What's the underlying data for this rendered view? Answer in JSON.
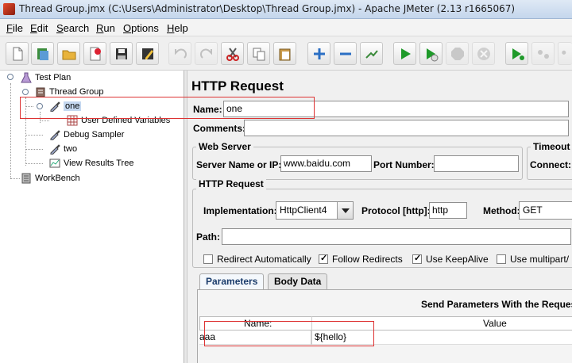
{
  "window": {
    "title": "Thread Group.jmx (C:\\Users\\Administrator\\Desktop\\Thread Group.jmx) - Apache JMeter (2.13 r1665067)"
  },
  "menu": [
    "File",
    "Edit",
    "Search",
    "Run",
    "Options",
    "Help"
  ],
  "toolbar": {
    "icons": [
      "new-icon",
      "templates-icon",
      "open-icon",
      "close-icon",
      "save-icon",
      "save-as-icon",
      "undo-icon",
      "redo-icon",
      "cut-icon",
      "copy-icon",
      "paste-icon",
      "expand-icon",
      "collapse-icon",
      "toggle-icon",
      "start-icon",
      "start-no-pause-icon",
      "stop-icon",
      "shutdown-icon",
      "remote-start-icon",
      "remote-stop-icon",
      "remote-exit-icon"
    ]
  },
  "tree": {
    "test_plan": "Test Plan",
    "thread_group": "Thread Group",
    "one": "one",
    "user_defined_variables": "User Defined Variables",
    "debug_sampler": "Debug Sampler",
    "two": "two",
    "view_results_tree": "View Results Tree",
    "workbench": "WorkBench"
  },
  "panel": {
    "title": "HTTP Request",
    "name_label": "Name:",
    "name_value": "one",
    "comments_label": "Comments:",
    "web_server": {
      "title": "Web Server",
      "server_label": "Server Name or IP:",
      "server_value": "www.baidu.com",
      "port_label": "Port Number:",
      "port_value": ""
    },
    "timeouts": {
      "title": "Timeout",
      "connect_label": "Connect:"
    },
    "http_request": {
      "title": "HTTP Request",
      "impl_label": "Implementation:",
      "impl_value": "HttpClient4",
      "protocol_label": "Protocol [http]:",
      "protocol_value": "http",
      "method_label": "Method:",
      "method_value": "GET",
      "path_label": "Path:",
      "path_value": ""
    },
    "checks": {
      "redirect_auto": {
        "label": "Redirect Automatically",
        "checked": false
      },
      "follow_redirects": {
        "label": "Follow Redirects",
        "checked": true
      },
      "keepalive": {
        "label": "Use KeepAlive",
        "checked": true
      },
      "multipart": {
        "label": "Use multipart/",
        "checked": false
      }
    },
    "tabs": [
      "Parameters",
      "Body Data"
    ],
    "params": {
      "header": "Send Parameters With the Reques",
      "col_name": "Name:",
      "col_value": "Value",
      "rows": [
        {
          "name": "aaa",
          "value": "${hello}"
        }
      ]
    }
  },
  "colors": {
    "highlight_box": "#dd3333",
    "selection": "#c5d8f0"
  }
}
